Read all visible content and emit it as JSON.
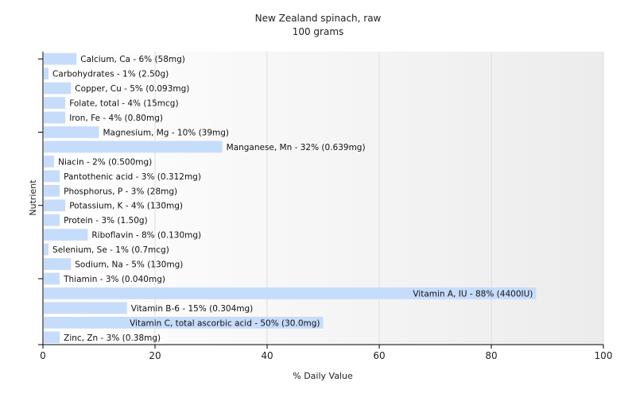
{
  "chart_data": {
    "type": "bar",
    "orientation": "horizontal",
    "title": "New Zealand spinach, raw",
    "subtitle": "100 grams",
    "xlabel": "% Daily Value",
    "ylabel": "Nutrient",
    "xlim": [
      0,
      100
    ],
    "xticks": [
      0,
      20,
      40,
      60,
      80,
      100
    ],
    "grid": true,
    "bar_color": "#c6dcfb",
    "categories": [
      "Calcium, Ca",
      "Carbohydrates",
      "Copper, Cu",
      "Folate, total",
      "Iron, Fe",
      "Magnesium, Mg",
      "Manganese, Mn",
      "Niacin",
      "Pantothenic acid",
      "Phosphorus, P",
      "Potassium, K",
      "Protein",
      "Riboflavin",
      "Selenium, Se",
      "Sodium, Na",
      "Thiamin",
      "Vitamin A, IU",
      "Vitamin B-6",
      "Vitamin C, total ascorbic acid",
      "Zinc, Zn"
    ],
    "values": [
      6,
      1,
      5,
      4,
      4,
      10,
      32,
      2,
      3,
      3,
      4,
      3,
      8,
      1,
      5,
      3,
      88,
      15,
      50,
      3
    ],
    "labels": [
      "Calcium, Ca - 6% (58mg)",
      "Carbohydrates - 1% (2.50g)",
      "Copper, Cu - 5% (0.093mg)",
      "Folate, total - 4% (15mcg)",
      "Iron, Fe - 4% (0.80mg)",
      "Magnesium, Mg - 10% (39mg)",
      "Manganese, Mn - 32% (0.639mg)",
      "Niacin - 2% (0.500mg)",
      "Pantothenic acid - 3% (0.312mg)",
      "Phosphorus, P - 3% (28mg)",
      "Potassium, K - 4% (130mg)",
      "Protein - 3% (1.50g)",
      "Riboflavin - 8% (0.130mg)",
      "Selenium, Se - 1% (0.7mcg)",
      "Sodium, Na - 5% (130mg)",
      "Thiamin - 3% (0.040mg)",
      "Vitamin A, IU - 88% (4400IU)",
      "Vitamin B-6 - 15% (0.304mg)",
      "Vitamin C, total ascorbic acid - 50% (30.0mg)",
      "Zinc, Zn - 3% (0.38mg)"
    ]
  }
}
